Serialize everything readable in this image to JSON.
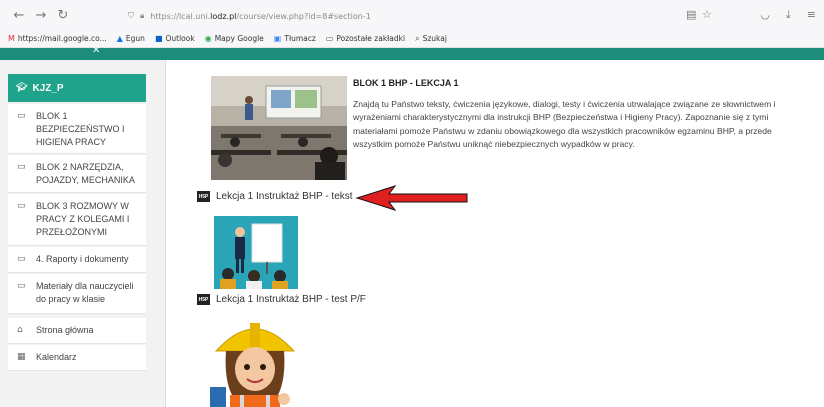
{
  "browser": {
    "url_host_prefix": "https://lcal.uni.",
    "url_host": "lodz.pl",
    "url_path": "/course/view.php?id=8#section-1"
  },
  "bookmarks": [
    {
      "icon": "gmail-icon",
      "label": "https://mail.google.co..."
    },
    {
      "icon": "drive-icon",
      "label": "Egun"
    },
    {
      "icon": "outlook-icon",
      "label": "Outlook"
    },
    {
      "icon": "maps-icon",
      "label": "Mapy Google"
    },
    {
      "icon": "translate-icon",
      "label": "Tłumacz"
    },
    {
      "icon": "folder-icon",
      "label": "Pozostałe zakładki"
    },
    {
      "icon": "search-icon",
      "label": "Szukaj"
    }
  ],
  "sidebar": {
    "course_name": "KJZ_P",
    "items": [
      {
        "label": "BLOK 1 BEZPIECZEŃSTWO I HIGIENA PRACY"
      },
      {
        "label": "BLOK 2 NARZĘDZIA, POJAZDY, MECHANIKA"
      },
      {
        "label": "BLOK 3 ROZMOWY W PRACY Z KOLEGAMI I PRZEŁOŻONYMI"
      },
      {
        "label": "4. Raporty i dokumenty"
      },
      {
        "label": "Materiały dla nauczycieli do pracy w klasie"
      }
    ],
    "links": [
      {
        "label": "Strona główna"
      },
      {
        "label": "Kalendarz"
      }
    ]
  },
  "section": {
    "title": "BLOK 1 BHP - LEKCJA 1",
    "description": "Znajdą tu Państwo teksty, ćwiczenia językowe, dialogi, testy i ćwiczenia utrwalające związane ze słownictwem i wyrażeniami charakterystycznymi dla instrukcji BHP (Bezpieczeństwa i Higieny Pracy). Zapoznanie się z tymi materiałami pomoże Państwu w zdaniu obowiązkowego dla wszystkich pracowników egzaminu BHP, a przede wszystkim pomoże Państwu uniknąć niebezpiecznych wypadków w pracy."
  },
  "activities": [
    {
      "icon_label": "H5P",
      "label": "Lekcja 1 Instruktaż BHP - tekst"
    },
    {
      "icon_label": "H5P",
      "label": "Lekcja 1 Instruktaż BHP - test P/F"
    }
  ],
  "colors": {
    "accent": "#1fa38a",
    "arrow": "#e02020"
  }
}
